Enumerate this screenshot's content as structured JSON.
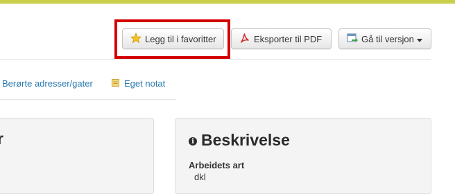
{
  "toolbar": {
    "favorite_label": "Legg til i favoritter",
    "favorite_icon": "star-icon",
    "pdf_label": "Eksporter til PDF",
    "pdf_icon": "pdf-icon",
    "version_label": "Gå til versjon",
    "version_icon": "go-to-version-icon",
    "highlight_color": "#d40000"
  },
  "tabs": {
    "addresses_label": "Berørte adresser/gater",
    "note_label": "Eget notat",
    "note_icon": "note-icon",
    "link_color": "#2a7ab0"
  },
  "panels": {
    "left_title_fragment": "r",
    "description": {
      "title": "Beskrivelse",
      "icon": "info-icon",
      "field_label": "Arbeidets art",
      "field_value": "dkl"
    }
  }
}
